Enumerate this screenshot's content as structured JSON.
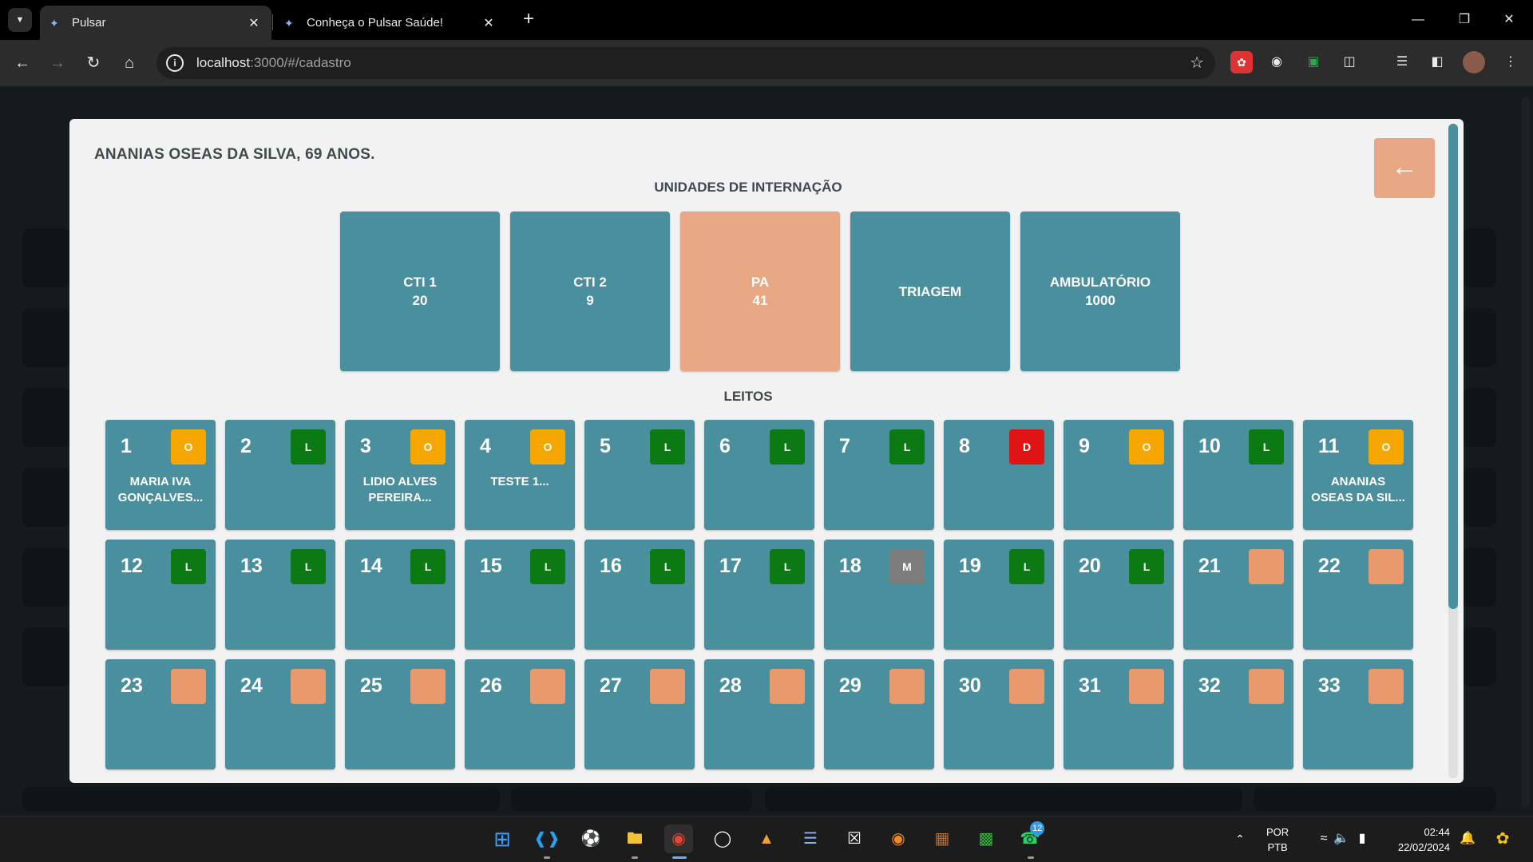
{
  "browser": {
    "tabs": [
      {
        "title": "Pulsar",
        "active": true
      },
      {
        "title": "Conheça o Pulsar Saúde!",
        "active": false
      }
    ],
    "url_host": "localhost",
    "url_path": ":3000/#/cadastro"
  },
  "modal": {
    "patient_header": "ANANIAS OSEAS DA SILVA, 69 ANOS.",
    "back_icon": "arrow-left-icon",
    "units_title": "UNIDADES DE INTERNAÇÃO",
    "beds_title": "LEITOS",
    "units": [
      {
        "name": "CTI 1",
        "count": "20",
        "selected": false
      },
      {
        "name": "CTI 2",
        "count": "9",
        "selected": false
      },
      {
        "name": "PA",
        "count": "41",
        "selected": true
      },
      {
        "name": "TRIAGEM",
        "count": "",
        "selected": false
      },
      {
        "name": "AMBULATÓRIO",
        "count": "1000",
        "selected": false
      }
    ],
    "beds": [
      {
        "number": "1",
        "status": "O",
        "patient": "MARIA IVA GONÇALVES..."
      },
      {
        "number": "2",
        "status": "L",
        "patient": ""
      },
      {
        "number": "3",
        "status": "O",
        "patient": "LIDIO ALVES PEREIRA..."
      },
      {
        "number": "4",
        "status": "O",
        "patient": "TESTE 1..."
      },
      {
        "number": "5",
        "status": "L",
        "patient": ""
      },
      {
        "number": "6",
        "status": "L",
        "patient": ""
      },
      {
        "number": "7",
        "status": "L",
        "patient": ""
      },
      {
        "number": "8",
        "status": "D",
        "patient": ""
      },
      {
        "number": "9",
        "status": "O",
        "patient": ""
      },
      {
        "number": "10",
        "status": "L",
        "patient": ""
      },
      {
        "number": "11",
        "status": "O",
        "patient": "ANANIAS OSEAS DA SIL..."
      },
      {
        "number": "12",
        "status": "L",
        "patient": ""
      },
      {
        "number": "13",
        "status": "L",
        "patient": ""
      },
      {
        "number": "14",
        "status": "L",
        "patient": ""
      },
      {
        "number": "15",
        "status": "L",
        "patient": ""
      },
      {
        "number": "16",
        "status": "L",
        "patient": ""
      },
      {
        "number": "17",
        "status": "L",
        "patient": ""
      },
      {
        "number": "18",
        "status": "M",
        "patient": ""
      },
      {
        "number": "19",
        "status": "L",
        "patient": ""
      },
      {
        "number": "20",
        "status": "L",
        "patient": ""
      },
      {
        "number": "21",
        "status": "",
        "patient": ""
      },
      {
        "number": "22",
        "status": "",
        "patient": ""
      },
      {
        "number": "23",
        "status": "",
        "patient": ""
      },
      {
        "number": "24",
        "status": "",
        "patient": ""
      },
      {
        "number": "25",
        "status": "",
        "patient": ""
      },
      {
        "number": "26",
        "status": "",
        "patient": ""
      },
      {
        "number": "27",
        "status": "",
        "patient": ""
      },
      {
        "number": "28",
        "status": "",
        "patient": ""
      },
      {
        "number": "29",
        "status": "",
        "patient": ""
      },
      {
        "number": "30",
        "status": "",
        "patient": ""
      },
      {
        "number": "31",
        "status": "",
        "patient": ""
      },
      {
        "number": "32",
        "status": "",
        "patient": ""
      },
      {
        "number": "33",
        "status": "",
        "patient": ""
      }
    ]
  },
  "status_colors": {
    "O": "#f5a700",
    "L": "#0b7a12",
    "D": "#e01414",
    "M": "#7d7d7d",
    "none": "#e89a6c"
  },
  "theme": {
    "teal": "#4a8f9d",
    "peach": "#e8a884"
  },
  "taskbar": {
    "lang_line1": "POR",
    "lang_line2": "PTB",
    "time": "02:44",
    "date": "22/02/2024",
    "whatsapp_badge": "12"
  }
}
